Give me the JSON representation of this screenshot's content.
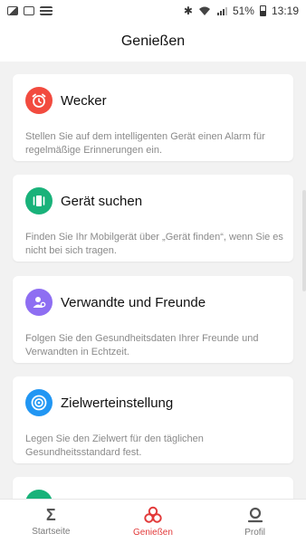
{
  "statusbar": {
    "battery": "51%",
    "time": "13:19",
    "icons": [
      "gallery-icon",
      "card-icon",
      "notes-icon",
      "bluetooth-icon",
      "wifi-icon",
      "signal-icon",
      "battery-icon"
    ]
  },
  "header": {
    "title": "Genießen"
  },
  "cards": [
    {
      "title": "Wecker",
      "description": "Stellen Sie auf dem intelligenten Gerät einen Alarm für regelmäßige Erinnerungen ein.",
      "icon": "alarm-clock-icon",
      "color": "#f24b3f"
    },
    {
      "title": "Gerät suchen",
      "description": "Finden Sie Ihr Mobilgerät über „Gerät finden“, wenn Sie es nicht bei sich tragen.",
      "icon": "vibrate-phone-icon",
      "color": "#19b27a"
    },
    {
      "title": "Verwandte und Freunde",
      "description": "Folgen Sie den Gesundheitsdaten Ihrer Freunde und Verwandten in Echtzeit.",
      "icon": "people-icon",
      "color": "#8e6ef2"
    },
    {
      "title": "Zielwerteinstellung",
      "description": "Legen Sie den Zielwert für den täglichen Gesundheitsstandard fest.",
      "icon": "target-icon",
      "color": "#2196f3"
    },
    {
      "title": "",
      "description": "",
      "icon": "partial-icon",
      "color": "#19b27a"
    }
  ],
  "bottom_nav": {
    "items": [
      {
        "label": "Startseite",
        "icon": "sigma-icon",
        "active": false
      },
      {
        "label": "Genießen",
        "icon": "enjoy-icon",
        "active": true
      },
      {
        "label": "Profil",
        "icon": "profile-icon",
        "active": false
      }
    ],
    "active_color": "#e23a3a"
  }
}
